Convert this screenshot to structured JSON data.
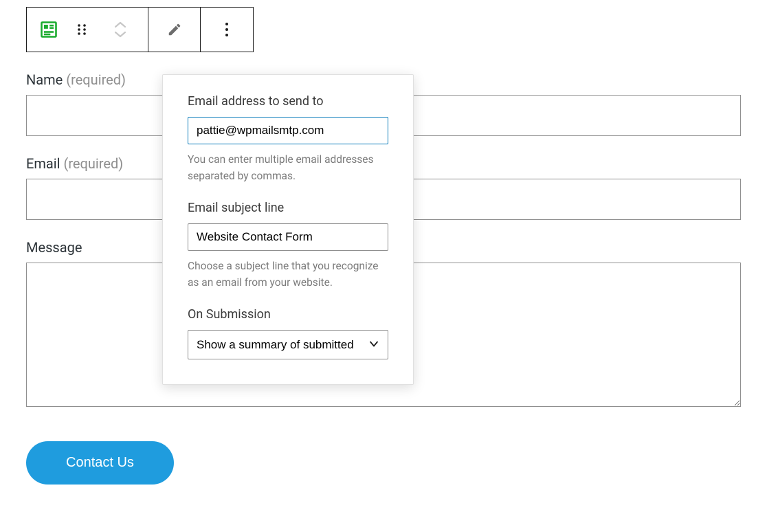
{
  "toolbar": {
    "block_icon": "form-block-icon",
    "drag_icon": "drag-handle-icon",
    "move_icon": "move-up-down-icon",
    "edit_icon": "pencil-icon",
    "more_icon": "more-options-icon"
  },
  "form": {
    "name": {
      "label": "Name",
      "required_text": "(required)",
      "value": ""
    },
    "email": {
      "label": "Email",
      "required_text": "(required)",
      "value": ""
    },
    "message": {
      "label": "Message",
      "value": ""
    },
    "submit_label": "Contact Us"
  },
  "popover": {
    "email_to": {
      "label": "Email address to send to",
      "value": "pattie@wpmailsmtp.com",
      "help": "You can enter multiple email addresses separated by commas."
    },
    "subject": {
      "label": "Email subject line",
      "value": "Website Contact Form",
      "help": "Choose a subject line that you recognize as an email from your website."
    },
    "on_submission": {
      "label": "On Submission",
      "selected": "Show a summary of submitted"
    }
  }
}
